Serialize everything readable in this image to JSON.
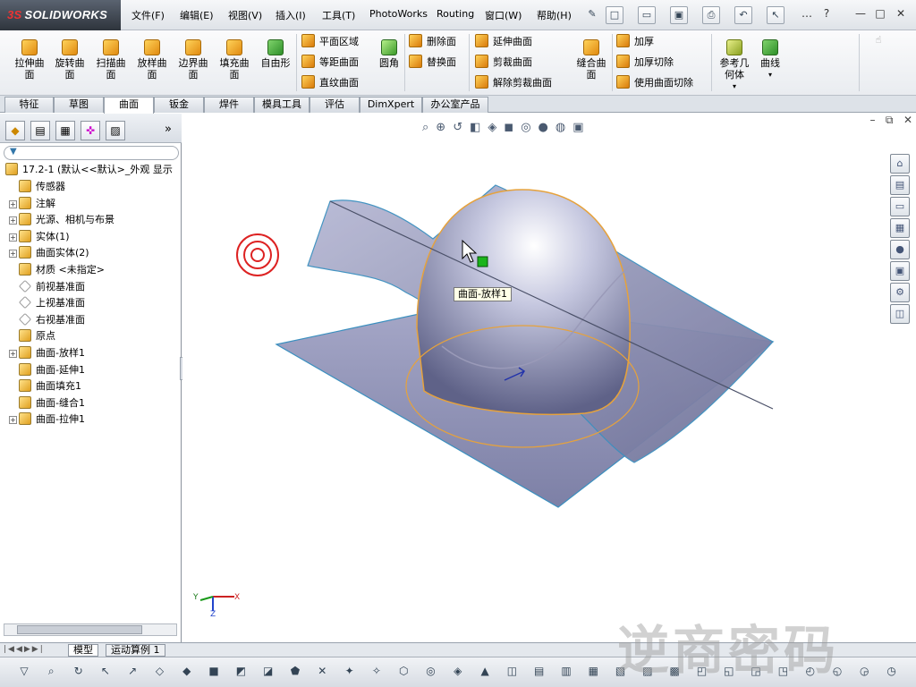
{
  "app": {
    "logo_prefix": "3S",
    "logo": "SOLIDWORKS"
  },
  "menu": [
    "文件(F)",
    "编辑(E)",
    "视图(V)",
    "插入(I)",
    "工具(T)",
    "PhotoWorks",
    "Routing",
    "窗口(W)",
    "帮助(H)"
  ],
  "ribbon": {
    "large": [
      "拉伸曲\n面",
      "旋转曲\n面",
      "扫描曲\n面",
      "放样曲\n面",
      "边界曲\n面",
      "填充曲\n面",
      "自由形"
    ],
    "col1": [
      "平面区域",
      "等距曲面",
      "直纹曲面"
    ],
    "fillet": "圆角",
    "col2": [
      "删除面",
      "替换面"
    ],
    "col3": [
      "延伸曲面",
      "剪裁曲面",
      "解除剪裁曲面"
    ],
    "knit": "缝合曲\n面",
    "col4": [
      "加厚",
      "加厚切除",
      "使用曲面切除"
    ],
    "ref": "参考几\n何体",
    "curves": "曲线"
  },
  "tabs": [
    "特征",
    "草图",
    "曲面",
    "钣金",
    "焊件",
    "模具工具",
    "评估",
    "DimXpert",
    "办公室产品"
  ],
  "active_tab": "曲面",
  "tree": {
    "root": "17.2-1  (默认<<默认>_外观 显示",
    "items": [
      {
        "label": "传感器",
        "exp": false,
        "plane": false
      },
      {
        "label": "注解",
        "exp": true,
        "plane": false
      },
      {
        "label": "光源、相机与布景",
        "exp": true,
        "plane": false
      },
      {
        "label": "实体(1)",
        "exp": true,
        "plane": false
      },
      {
        "label": "曲面实体(2)",
        "exp": true,
        "plane": false
      },
      {
        "label": "材质 <未指定>",
        "exp": false,
        "plane": false
      },
      {
        "label": "前视基准面",
        "exp": false,
        "plane": true
      },
      {
        "label": "上视基准面",
        "exp": false,
        "plane": true
      },
      {
        "label": "右视基准面",
        "exp": false,
        "plane": true
      },
      {
        "label": "原点",
        "exp": false,
        "plane": false
      },
      {
        "label": "曲面-放样1",
        "exp": true,
        "plane": false
      },
      {
        "label": "曲面-延伸1",
        "exp": false,
        "plane": false
      },
      {
        "label": "曲面填充1",
        "exp": false,
        "plane": false
      },
      {
        "label": "曲面-缝合1",
        "exp": false,
        "plane": false
      },
      {
        "label": "曲面-拉伸1",
        "exp": true,
        "plane": false
      }
    ]
  },
  "viewport": {
    "tooltip": "曲面-放样1",
    "triad": {
      "x": "X",
      "y": "Y",
      "z": "Z"
    }
  },
  "status_tabs": [
    "模型",
    "运动算例 1"
  ],
  "watermark": "逆商密码",
  "colors": {
    "accent": "#e6a23c",
    "edge": "#3a8fbf",
    "surface": "#8c8fb8"
  }
}
